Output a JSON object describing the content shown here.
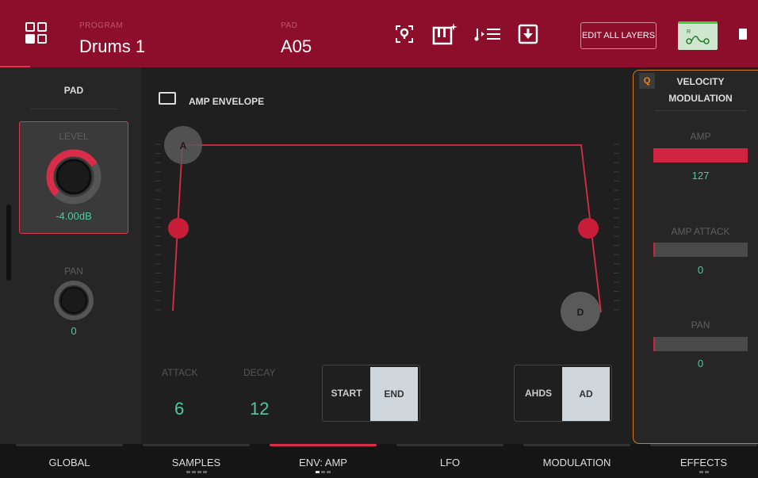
{
  "header": {
    "program_label": "PROGRAM",
    "program_value": "Drums 1",
    "pad_label": "PAD",
    "pad_value": "A05",
    "edit_all_layers": "EDIT ALL LAYERS",
    "icons": [
      "menu-grid-icon",
      "location-pin-icon",
      "keyboard-sparkle-icon",
      "note-list-icon",
      "download-icon",
      "routing-icon",
      "chip-icon"
    ]
  },
  "left_panel": {
    "title": "PAD",
    "level_label": "LEVEL",
    "level_value": "-4.00dB",
    "level_fraction": 0.72,
    "pan_label": "PAN",
    "pan_value": "0"
  },
  "main": {
    "title": "AMP ENVELOPE",
    "attack_label": "ATTACK",
    "attack_value": "6",
    "decay_label": "DECAY",
    "decay_value": "12",
    "handle_a": "A",
    "handle_d": "D",
    "curve_toggle": {
      "options": [
        "START",
        "END"
      ],
      "active": "END"
    },
    "mode_toggle": {
      "options": [
        "AHDS",
        "AD"
      ],
      "active": "AD"
    }
  },
  "right_panel": {
    "q_badge": "Q",
    "title_line1": "VELOCITY",
    "title_line2": "MODULATION",
    "items": [
      {
        "label": "AMP",
        "value": "127",
        "fraction": 1.0
      },
      {
        "label": "AMP ATTACK",
        "value": "0",
        "fraction": 0.0
      },
      {
        "label": "PAN",
        "value": "0",
        "fraction": 0.0
      }
    ]
  },
  "tabs": [
    {
      "label": "GLOBAL",
      "active": false,
      "dots": 0,
      "dot_on": -1
    },
    {
      "label": "SAMPLES",
      "active": false,
      "dots": 4,
      "dot_on": -1
    },
    {
      "label": "ENV: AMP",
      "active": true,
      "dots": 3,
      "dot_on": 0
    },
    {
      "label": "LFO",
      "active": false,
      "dots": 0,
      "dot_on": -1
    },
    {
      "label": "MODULATION",
      "active": false,
      "dots": 0,
      "dot_on": -1
    },
    {
      "label": "EFFECTS",
      "active": false,
      "dots": 2,
      "dot_on": -1
    }
  ],
  "colors": {
    "header_bg": "#8c0e2a",
    "accent_red": "#d92c48",
    "value_green": "#4fc9a0",
    "velocity_border": "#d07a2a"
  }
}
